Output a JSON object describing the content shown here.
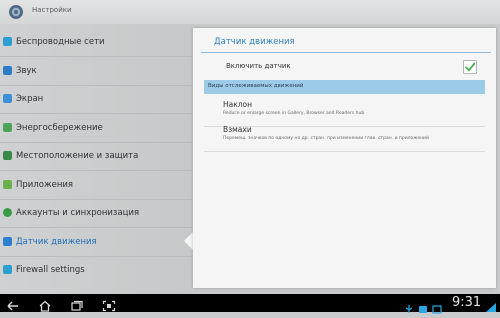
{
  "app": {
    "title": "Настройки",
    "icon": "settings-gear-icon"
  },
  "sidebar": {
    "items": [
      {
        "label": "Беспроводные сети",
        "icon": "wireless-icon",
        "color": "#2a9fd0"
      },
      {
        "label": "Звук",
        "icon": "sound-icon",
        "color": "#2e7bc8"
      },
      {
        "label": "Экран",
        "icon": "display-icon",
        "color": "#3a8fd8"
      },
      {
        "label": "Энергосбережение",
        "icon": "battery-icon",
        "color": "#4aa55a"
      },
      {
        "label": "Местоположение и защита",
        "icon": "location-icon",
        "color": "#3c8a4a"
      },
      {
        "label": "Приложения",
        "icon": "apps-icon",
        "color": "#6bb04a"
      },
      {
        "label": "Аккаунты и синхронизация",
        "icon": "sync-icon",
        "color": "#3a9a48"
      },
      {
        "label": "Датчик движения",
        "icon": "motion-sensor-icon",
        "color": "#2f7fd0",
        "active": true
      },
      {
        "label": "Firewall settings",
        "icon": "firewall-icon",
        "color": "#2a9fd0"
      }
    ]
  },
  "panel": {
    "title": "Датчик движения",
    "enable_label": "Включить датчик",
    "enable_checked": true,
    "section_header": "Виды отслеживаемых движений",
    "gestures": [
      {
        "title": "Наклон",
        "description": "Reduce or enlarge screen in Gallery, Browser and Readers hub"
      },
      {
        "title": "Взмахи",
        "description": "Перемещ. значков по одному на др. стран. при изменении глав. стран. и приложений"
      }
    ]
  },
  "navbar": {
    "clock": "9:31",
    "buttons": [
      "back-icon",
      "home-icon",
      "recent-apps-icon",
      "screenshot-icon"
    ],
    "accent": "#2aa6e0"
  }
}
